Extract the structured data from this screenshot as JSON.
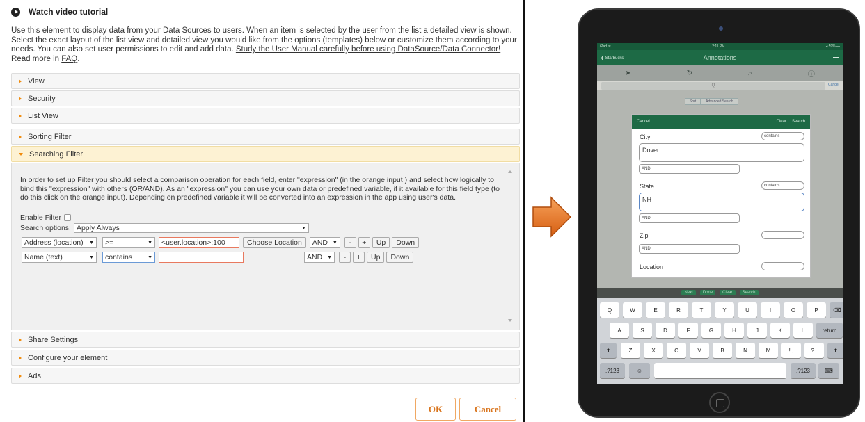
{
  "tutorial": {
    "label": "Watch video tutorial"
  },
  "intro": {
    "text": "Use this element to display data from your Data Sources to users. When an item is selected by the user from the list a detailed view is shown. Select the exact layout of the list view and detailed view you would like from the options (templates) below or customize them according to your needs. You can also set user permissions to edit and add data. ",
    "manual_link": "Study the User Manual carefully before using DataSource/Data Connector!",
    "read_more": "Read more in ",
    "faq_link": "FAQ",
    "period": "."
  },
  "accordion": {
    "view": "View",
    "security": "Security",
    "list_view": "List View",
    "sorting_filter": "Sorting Filter",
    "searching_filter": "Searching Filter",
    "share_settings": "Share Settings",
    "configure": "Configure your element",
    "ads": "Ads"
  },
  "filter": {
    "description": "In order to set up Filter you should select a comparison operation for each field, enter \"expression\" (in the orange input ) and select how logically to bind this \"expression\" with others (OR/AND). As an \"expression\" you can use your own data or predefined variable, if it available for this field type (to do this click on the orange input). Depending on predefined variable it will be converted into an expression in the app using user's data.",
    "enable_label": "Enable Filter",
    "enable_checked": false,
    "search_options_label": "Search options:",
    "search_options_value": "Apply Always",
    "rows": [
      {
        "field": "Address (location)",
        "op": ">=",
        "expr": "<user.location>:100",
        "choose": "Choose Location",
        "logic": "AND"
      },
      {
        "field": "Name (text)",
        "op": "contains",
        "expr": "",
        "logic": "AND"
      }
    ],
    "minus": "-",
    "plus": "+",
    "up": "Up",
    "down": "Down"
  },
  "buttons": {
    "ok": "OK",
    "cancel": "Cancel"
  },
  "tablet": {
    "status_left": "iPad ᯤ",
    "status_time": "2:11 PM",
    "status_right": "◂ 59% ▬",
    "back": "Starbucks",
    "title": "Annotations",
    "search_placeholder": "Q",
    "search_cancel": "Cancel",
    "seg_sort": "Sort",
    "seg_advanced": "Advanced Search",
    "modal": {
      "cancel": "Cancel",
      "clear": "Clear",
      "search": "Search",
      "city_label": "City",
      "city_op": "contains",
      "city_value": "Dover",
      "city_logic": "AND",
      "state_label": "State",
      "state_op": "contains",
      "state_value": "NH",
      "state_logic": "AND",
      "zip_label": "Zip",
      "zip_logic": "AND",
      "location_label": "Location"
    },
    "kb_bar": [
      "Next",
      "Done",
      "Clear",
      "Search"
    ],
    "keys_row1": [
      "Q",
      "W",
      "E",
      "R",
      "T",
      "Y",
      "U",
      "I",
      "O",
      "P"
    ],
    "keys_row2": [
      "A",
      "S",
      "D",
      "F",
      "G",
      "H",
      "J",
      "K",
      "L"
    ],
    "keys_row3": [
      "Z",
      "X",
      "C",
      "V",
      "B",
      "N",
      "M",
      "!\n,",
      "?\n."
    ],
    "return": "return",
    "num": ".?123",
    "emoji": "☺"
  }
}
